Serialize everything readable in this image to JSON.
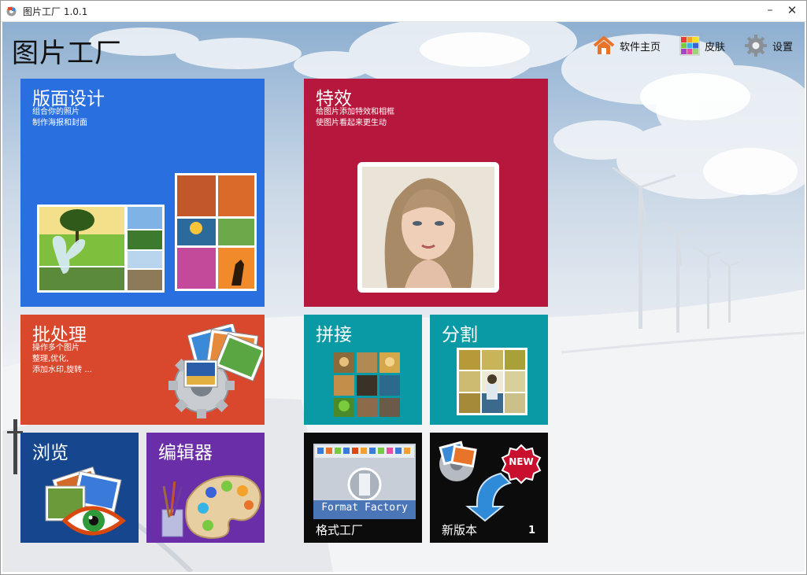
{
  "window": {
    "title": "图片工厂 1.0.1",
    "minimize_glyph": "–",
    "close_glyph": "✕"
  },
  "app": {
    "title": "图片工厂"
  },
  "nav": {
    "home": {
      "label": "软件主页",
      "icon": "house-icon"
    },
    "skin": {
      "label": "皮肤",
      "icon": "color-grid-icon"
    },
    "settings": {
      "label": "设置",
      "icon": "gear-icon"
    }
  },
  "tiles": {
    "layout": {
      "title": "版面设计",
      "desc": [
        "组合你的照片",
        "制作海报和封面"
      ],
      "color": "#2a6fe0"
    },
    "effects": {
      "title": "特效",
      "desc": [
        "给图片添加特效和相框",
        "使图片看起来更生动"
      ],
      "color": "#b5183c"
    },
    "batch": {
      "title": "批处理",
      "desc": [
        "操作多个图片",
        "整理,优化,",
        "添加水印,旋转 ..."
      ],
      "color": "#d9472c"
    },
    "join": {
      "title": "拼接",
      "color": "#0a9aa6"
    },
    "split": {
      "title": "分割",
      "color": "#0a9aa6"
    },
    "browse": {
      "title": "浏览",
      "color": "#16478e"
    },
    "editor": {
      "title": "编辑器",
      "color": "#6a2ea8"
    },
    "format_factory": {
      "label": "格式工厂",
      "logo_text": "Format Factory",
      "color": "#0c0c0c"
    },
    "new_version": {
      "label": "新版本",
      "badge": "NEW",
      "count": "1",
      "color": "#0c0c0c"
    }
  }
}
